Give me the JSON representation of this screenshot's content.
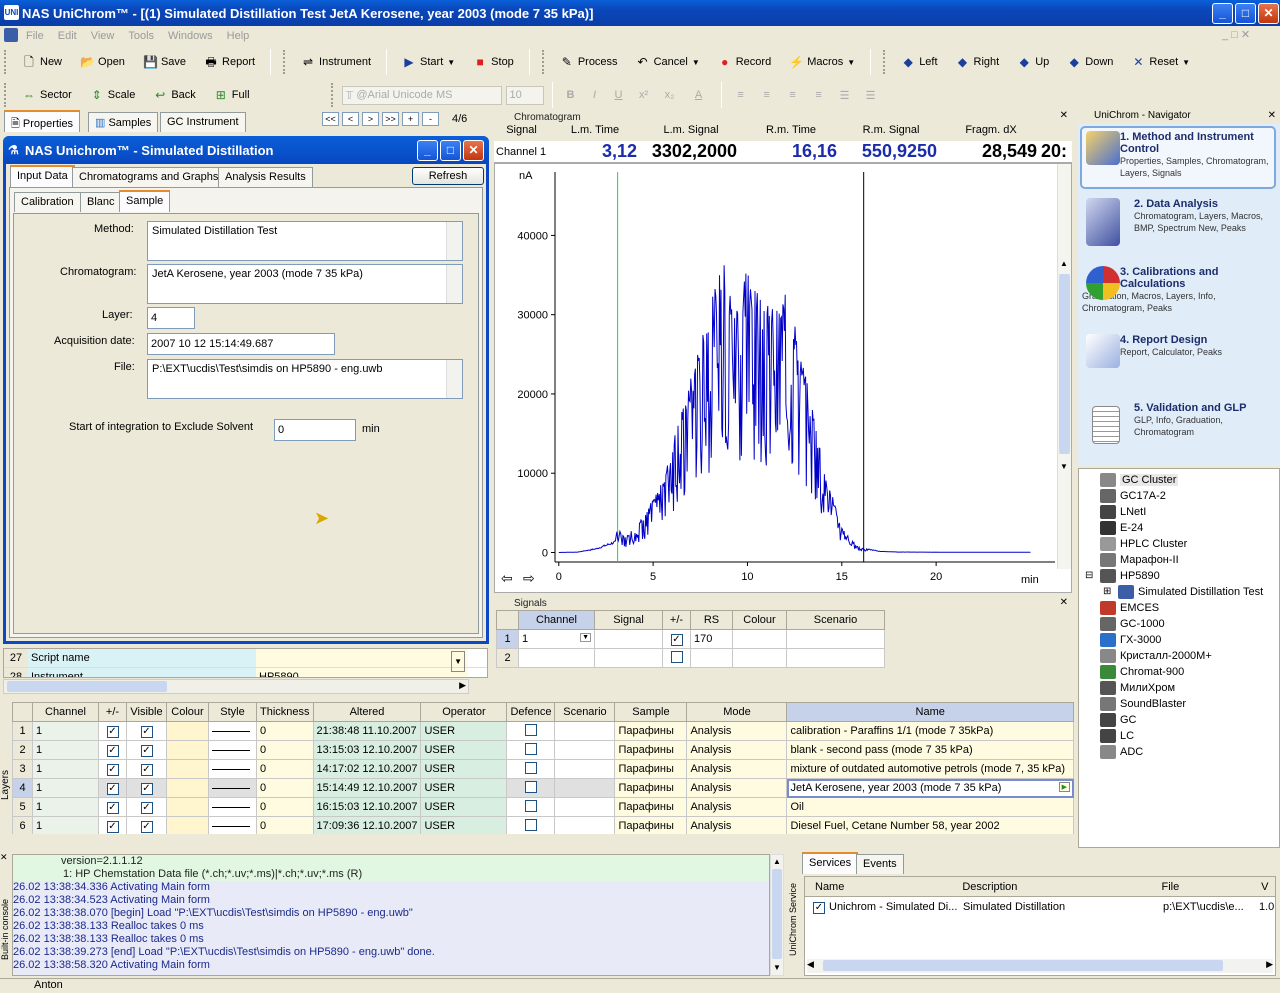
{
  "window": {
    "title": "NAS UniChrom™ - [(1) Simulated Distillation Test JetA Kerosene, year 2003 (mode 7 35 kPa)]"
  },
  "menu": [
    "File",
    "Edit",
    "View",
    "Tools",
    "Windows",
    "Help"
  ],
  "toolbar1": {
    "new": "New",
    "open": "Open",
    "save": "Save",
    "report": "Report",
    "instrument": "Instrument",
    "start": "Start",
    "stop": "Stop",
    "process": "Process",
    "cancel": "Cancel",
    "record": "Record",
    "macros": "Macros",
    "left": "Left",
    "right": "Right",
    "up": "Up",
    "down": "Down",
    "reset": "Reset"
  },
  "toolbar2": {
    "sector": "Sector",
    "scale": "Scale",
    "back": "Back",
    "full": "Full",
    "font": "@Arial Unicode MS",
    "size": "10",
    "bold": "B",
    "italic": "I",
    "underline": "U",
    "sup": "x²",
    "sub": "x₂",
    "fontcolor": "A"
  },
  "lefttabs": {
    "properties": "Properties",
    "samples": "Samples",
    "gc": "GC Instrument"
  },
  "pager": {
    "first": "<<",
    "prev": "<",
    "next": ">",
    "last": ">>",
    "add": "+",
    "remove": "-",
    "pos": "4/6"
  },
  "dialog": {
    "title": "NAS Unichrom™ - Simulated Distillation",
    "tabs": [
      "Input Data",
      "Chromatograms and Graphs",
      "Analysis Results"
    ],
    "refresh": "Refresh",
    "subtabs": [
      "Calibration",
      "Blanc",
      "Sample"
    ],
    "method_label": "Method:",
    "method": "Simulated Distillation Test",
    "chrom_label": "Chromatogram:",
    "chrom": "JetA Kerosene, year 2003 (mode 7 35 kPa)",
    "layer_label": "Layer:",
    "layer": "4",
    "acq_label": "Acquisition date:",
    "acq": "2007 10 12 15:14:49.687",
    "file_label": "File:",
    "file": "P:\\EXT\\ucdis\\Test\\simdis on HP5890 - eng.uwb",
    "solvent_label": "Start of integration to Exclude Solvent",
    "solvent": "0",
    "solvent_unit": "min"
  },
  "proprows": [
    {
      "n": "27",
      "k": "Script name",
      "v": ""
    },
    {
      "n": "28",
      "k": "Instrument",
      "v": "HP5890"
    }
  ],
  "chromatogram": {
    "panel": "Chromatogram",
    "headers": [
      "Signal",
      "L.m. Time",
      "L.m. Signal",
      "R.m. Time",
      "R.m. Signal",
      "Fragm. dX"
    ],
    "channel": "Channel 1",
    "lmtime": "3,12",
    "lmsignal": "3302,2000",
    "rmtime": "16,16",
    "rmsignal": "550,9250",
    "fragdx": "28,549",
    "extra": "20:",
    "ylabel": "nA",
    "xlabel": "min",
    "yticks": [
      "40000",
      "30000",
      "20000",
      "10000",
      "0"
    ],
    "xticks": [
      "0",
      "5",
      "10",
      "15",
      "20"
    ]
  },
  "chart_data": {
    "type": "line",
    "xlabel": "min",
    "ylabel": "nA",
    "xlim": [
      -0.2,
      26.3
    ],
    "ylim": [
      -1200,
      48000
    ],
    "markers": [
      3.12,
      16.16
    ],
    "series": [
      {
        "values": [
          [
            0,
            0
          ],
          [
            1,
            50
          ],
          [
            2,
            500
          ],
          [
            3,
            1400
          ],
          [
            3.12,
            3302
          ],
          [
            3.5,
            1800
          ],
          [
            4,
            3000
          ],
          [
            4.5,
            4500
          ],
          [
            5,
            6500
          ],
          [
            5.5,
            9000
          ],
          [
            6,
            13000
          ],
          [
            6.5,
            17000
          ],
          [
            7,
            21000
          ],
          [
            7.5,
            26000
          ],
          [
            8,
            29000
          ],
          [
            8.5,
            35000
          ],
          [
            8.7,
            38500
          ],
          [
            9,
            31000
          ],
          [
            9.5,
            33000
          ],
          [
            10,
            34000
          ],
          [
            10.5,
            33000
          ],
          [
            11,
            30000
          ],
          [
            11.5,
            29000
          ],
          [
            12,
            31000
          ],
          [
            12.5,
            28000
          ],
          [
            13,
            22000
          ],
          [
            13.5,
            17000
          ],
          [
            14,
            11000
          ],
          [
            14.5,
            7000
          ],
          [
            15,
            3000
          ],
          [
            15.5,
            1500
          ],
          [
            16,
            500
          ],
          [
            16.16,
            551
          ],
          [
            17,
            150
          ],
          [
            18,
            60
          ],
          [
            20,
            40
          ],
          [
            25,
            30
          ]
        ]
      }
    ]
  },
  "signals": {
    "panel": "Signals",
    "headers": [
      "Channel",
      "Signal",
      "+/-",
      "RS",
      "Colour",
      "Scenario"
    ],
    "rows": [
      {
        "n": "1",
        "ch": "1",
        "rs": "170",
        "checked": "✓"
      },
      {
        "n": "2",
        "ch": "",
        "rs": "",
        "checked": ""
      }
    ]
  },
  "layers": {
    "label": "Layers",
    "headers": [
      "",
      "Channel",
      "+/-",
      "Visible",
      "Colour",
      "Style",
      "Thickness",
      "Altered",
      "Operator",
      "Defence",
      "Scenario",
      "Sample",
      "Mode",
      "Name"
    ],
    "rows": [
      {
        "n": "1",
        "ch": "1",
        "th": "0",
        "alt": "21:38:48 11.10.2007",
        "op": "USER",
        "sample": "Парафины",
        "mode": "Analysis",
        "name": "calibration - Paraffins 1/1 (mode 7 35kPa)"
      },
      {
        "n": "2",
        "ch": "1",
        "th": "0",
        "alt": "13:15:03 12.10.2007",
        "op": "USER",
        "sample": "Парафины",
        "mode": "Analysis",
        "name": "blank - second pass (mode 7 35 kPa)"
      },
      {
        "n": "3",
        "ch": "1",
        "th": "0",
        "alt": "14:17:02 12.10.2007",
        "op": "USER",
        "sample": "Парафины",
        "mode": "Analysis",
        "name": "mixture of outdated automotive petrols (mode 7, 35 kPa)"
      },
      {
        "n": "4",
        "ch": "1",
        "th": "0",
        "alt": "15:14:49 12.10.2007",
        "op": "USER",
        "sample": "Парафины",
        "mode": "Analysis",
        "name": "JetA Kerosene, year 2003 (mode 7 35 kPa)"
      },
      {
        "n": "5",
        "ch": "1",
        "th": "0",
        "alt": "16:15:03 12.10.2007",
        "op": "USER",
        "sample": "Парафины",
        "mode": "Analysis",
        "name": "Oil"
      },
      {
        "n": "6",
        "ch": "1",
        "th": "0",
        "alt": "17:09:36 12.10.2007",
        "op": "USER",
        "sample": "Парафины",
        "mode": "Analysis",
        "name": "Diesel Fuel, Cetane Number 58, year 2002"
      }
    ]
  },
  "console": {
    "label": "Built-in console",
    "lines": [
      "version=2.1.1.12",
      "1: HP Chemstation Data file (*.ch;*.uv;*.ms)|*.ch;*.uv;*.ms (R)",
      "26.02 13:38:34.336 Activating Main form",
      "26.02 13:38:34.523 Activating Main form",
      "26.02 13:38:38.070 [begin] Load \"P:\\EXT\\ucdis\\Test\\simdis on HP5890 - eng.uwb\"",
      "26.02 13:38:38.133 Realloc takes 0 ms",
      "26.02 13:38:38.133 Realloc takes 0 ms",
      "26.02 13:38:39.273 [end] Load \"P:\\EXT\\ucdis\\Test\\simdis on HP5890 - eng.uwb\" done.",
      "26.02 13:38:58.320 Activating Main form"
    ]
  },
  "services": {
    "label": "UniChrom Service",
    "tabs": [
      "Services",
      "Events"
    ],
    "headers": [
      "Name",
      "Description",
      "File",
      "V"
    ],
    "row": {
      "name": "Unichrom - Simulated Di...",
      "desc": "Simulated Distillation",
      "file": "p:\\EXT\\ucdis\\e...",
      "v": "1.0"
    }
  },
  "navigator": {
    "title": "UniChrom - Navigator",
    "items": [
      {
        "t": "1. Method and Instrument Control",
        "s": "Properties, Samples, Chromatogram, Layers, Signals"
      },
      {
        "t": "2. Data Analysis",
        "s": "Chromatogram, Layers, Macros, BMP, Spectrum New, Peaks"
      },
      {
        "t": "3. Calibrations and Calculations",
        "s": "Graduation, Macros, Layers, Info, Chromatogram, Peaks"
      },
      {
        "t": "4. Report Design",
        "s": "Report, Calculator, Peaks"
      },
      {
        "t": "5. Validation and GLP",
        "s": "GLP, Info, Graduation, Chromatogram"
      }
    ]
  },
  "tree": [
    "GC Cluster",
    "GC17A-2",
    "LNetI",
    "E-24",
    "HPLC Cluster",
    "Марафон-II",
    "HP5890",
    "Simulated Distillation Test",
    "EMCES",
    "GC-1000",
    "ГХ-3000",
    "Кристалл-2000М+",
    "Chromat-900",
    "МилиХром",
    "SoundBlaster",
    "GC",
    "LC",
    "ADC"
  ],
  "statusbar": {
    "user": "Anton"
  }
}
